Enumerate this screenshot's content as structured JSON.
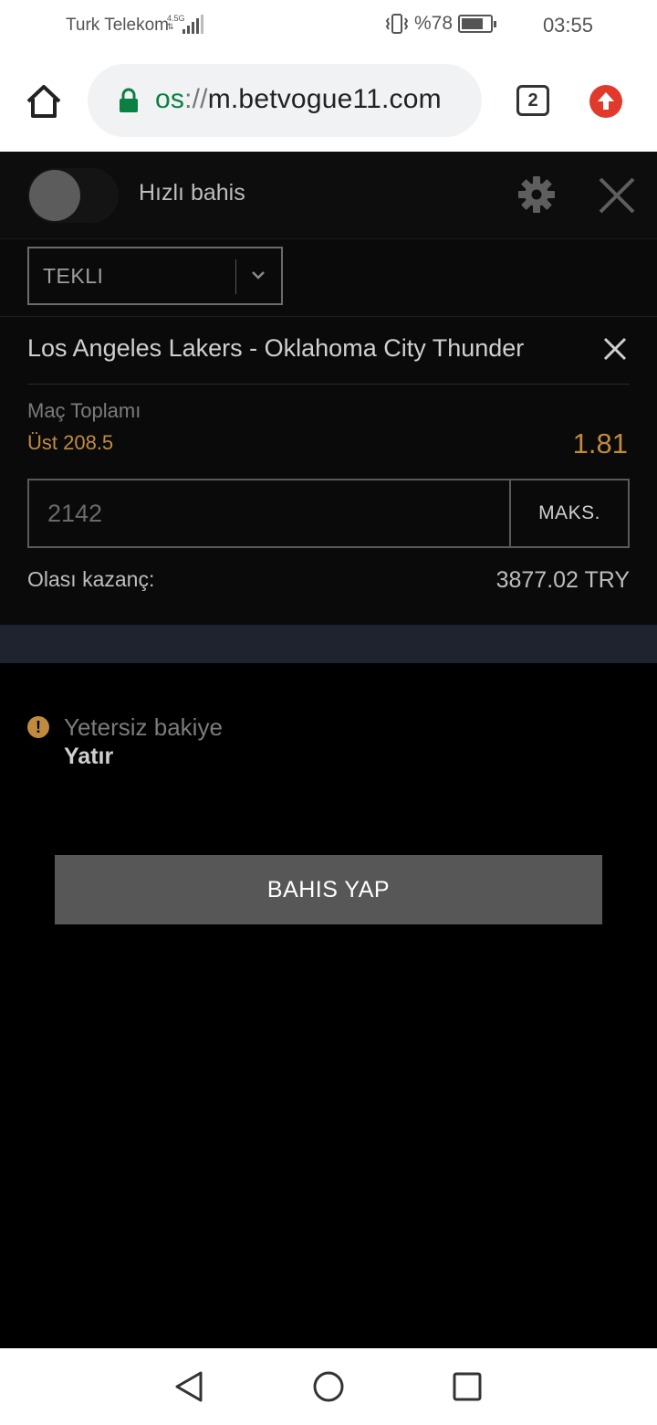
{
  "status_bar": {
    "carrier": "Turk Telekom",
    "network_badge_top": "4.5G",
    "network_badge_bottom": "⇅",
    "battery_text": "%78",
    "battery_level": 0.78,
    "time": "03:55"
  },
  "browser": {
    "url_scheme": "os",
    "url_separator": "://",
    "url_host": "m.betvogue11.com",
    "tab_count": "2",
    "icons": [
      "home-icon",
      "lock-icon",
      "tabs-icon",
      "update-icon"
    ]
  },
  "slip": {
    "quick_bet_label": "Hızlı bahis",
    "quick_bet_enabled": false,
    "bet_type": "TEKLI",
    "match": "Los Angeles Lakers - Oklahoma City Thunder",
    "market": "Maç Toplamı",
    "selection": "Üst 208.5",
    "odds": "1.81",
    "stake_value": "2142",
    "max_label": "MAKS.",
    "possible_win_label": "Olası kazanç:",
    "possible_win_value": "3877.02 TRY"
  },
  "warning": {
    "message": "Yetersiz bakiye",
    "deposit_link": "Yatır",
    "icon": "!"
  },
  "actions": {
    "place_bet": "BAHIS YAP"
  },
  "colors": {
    "accent_gold": "#c08b3e",
    "panel_bg": "#0a0a0a",
    "band_navy": "#1f2330",
    "button_gray": "#575757",
    "url_green": "#0b8043",
    "update_red": "#e13a2c"
  }
}
